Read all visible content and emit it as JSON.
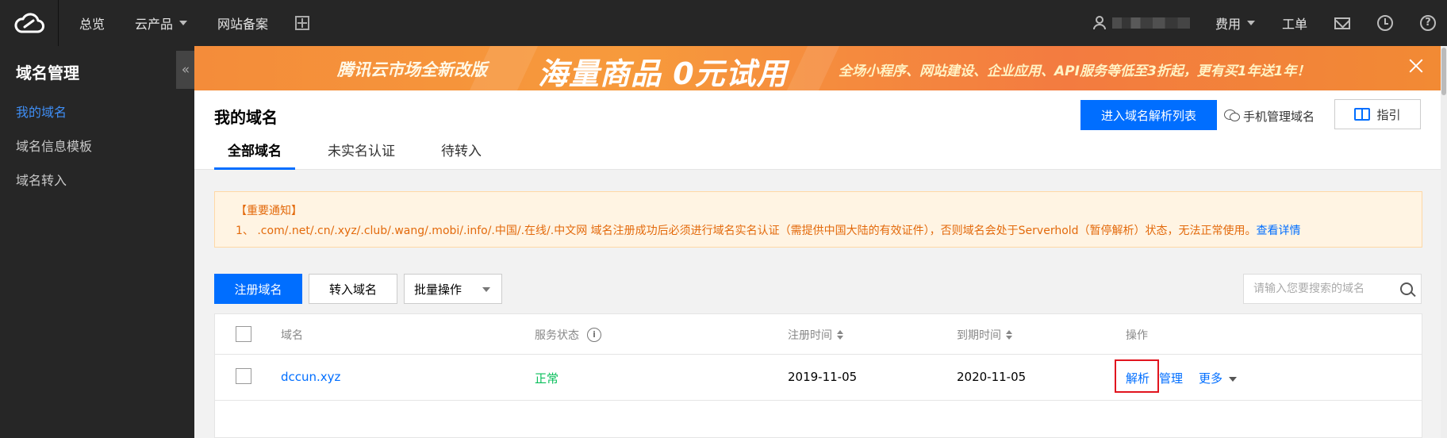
{
  "topbar": {
    "logo_icon": "cloud-logo-icon",
    "nav": [
      {
        "label": "总览",
        "has_caret": false
      },
      {
        "label": "云产品",
        "has_caret": true
      },
      {
        "label": "网站备案",
        "has_caret": false
      }
    ],
    "add_icon": "plus-square-icon",
    "user_icon": "user-icon",
    "fee_label": "费用",
    "ticket_label": "工单",
    "mail_icon": "mail-icon",
    "clock_icon": "clock-icon",
    "help_icon": "help-icon",
    "help_glyph": "?"
  },
  "sidebar": {
    "title": "域名管理",
    "collapse_glyph": "«",
    "items": [
      {
        "label": "我的域名",
        "active": true
      },
      {
        "label": "域名信息模板",
        "active": false
      },
      {
        "label": "域名转入",
        "active": false
      }
    ]
  },
  "banner": {
    "part1": "腾讯云市场全新改版",
    "part2": "海量商品  0元试用",
    "part3": "全场小程序、网站建设、企业应用、API服务等低至3折起，更有买1年送1年！",
    "colors": {
      "start": "#f48c3a",
      "end": "#f28a34"
    }
  },
  "header": {
    "title": "我的域名",
    "dns_list_button": "进入域名解析列表",
    "mobile_manage_label": "手机管理域名",
    "guide_label": "指引",
    "tabs": [
      {
        "label": "全部域名",
        "active": true
      },
      {
        "label": "未实名认证",
        "active": false
      },
      {
        "label": "待转入",
        "active": false
      }
    ]
  },
  "notice": {
    "title": "【重要通知】",
    "body": "1、 .com/.net/.cn/.xyz/.club/.wang/.mobi/.info/.中国/.在线/.中文网 域名注册成功后必须进行域名实名认证（需提供中国大陆的有效证件），否则域名会处于Serverhold（暂停解析）状态，无法正常使用。",
    "link": "查看详情"
  },
  "toolbar": {
    "register_button": "注册域名",
    "transfer_button": "转入域名",
    "batch_select": "批量操作",
    "search_placeholder": "请输入您要搜索的域名"
  },
  "table": {
    "columns": {
      "domain": "域名",
      "status": "服务状态",
      "reg_time": "注册时间",
      "exp_time": "到期时间",
      "actions": "操作"
    },
    "info_glyph": "i",
    "rows": [
      {
        "domain": "dccun.xyz",
        "status": "正常",
        "reg_time": "2019-11-05",
        "exp_time": "2020-11-05",
        "op_resolve": "解析",
        "op_manage": "管理",
        "op_more": "更多"
      }
    ]
  },
  "colors": {
    "primary": "#006eff",
    "topbar": "#262626",
    "status_ok": "#0abf5b",
    "notice_text": "#e36a0c",
    "highlight_border": "#e1141e"
  }
}
